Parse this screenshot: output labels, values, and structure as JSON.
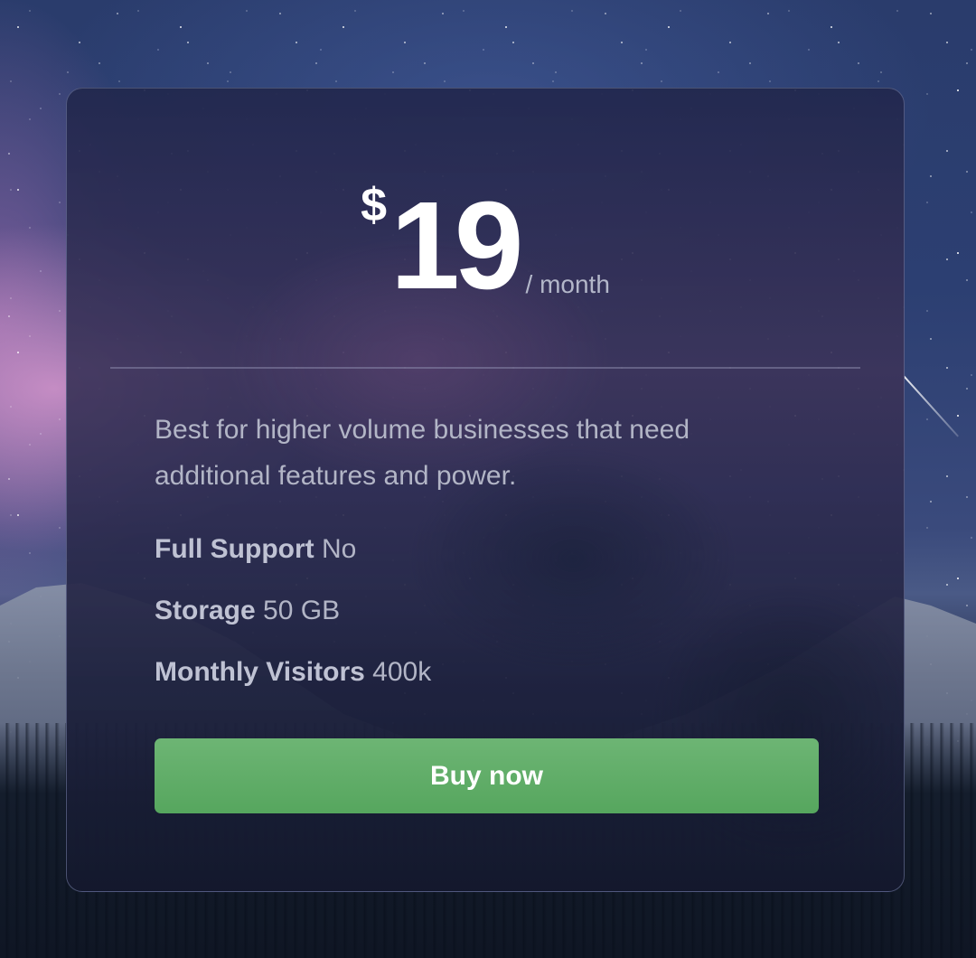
{
  "colors": {
    "card_bg": "#2a2f55",
    "accent_green": "#5daa65",
    "text_primary": "#ffffff",
    "text_muted": "#b2b5c6"
  },
  "pricing_card": {
    "currency": "$",
    "amount": "19",
    "period": "/ month",
    "description": "Best for higher volume businesses that need additional features and power.",
    "features": [
      {
        "label": "Full Support",
        "value": "No"
      },
      {
        "label": "Storage",
        "value": "50 GB"
      },
      {
        "label": "Monthly Visitors",
        "value": "400k"
      }
    ],
    "button_label": "Buy now"
  }
}
